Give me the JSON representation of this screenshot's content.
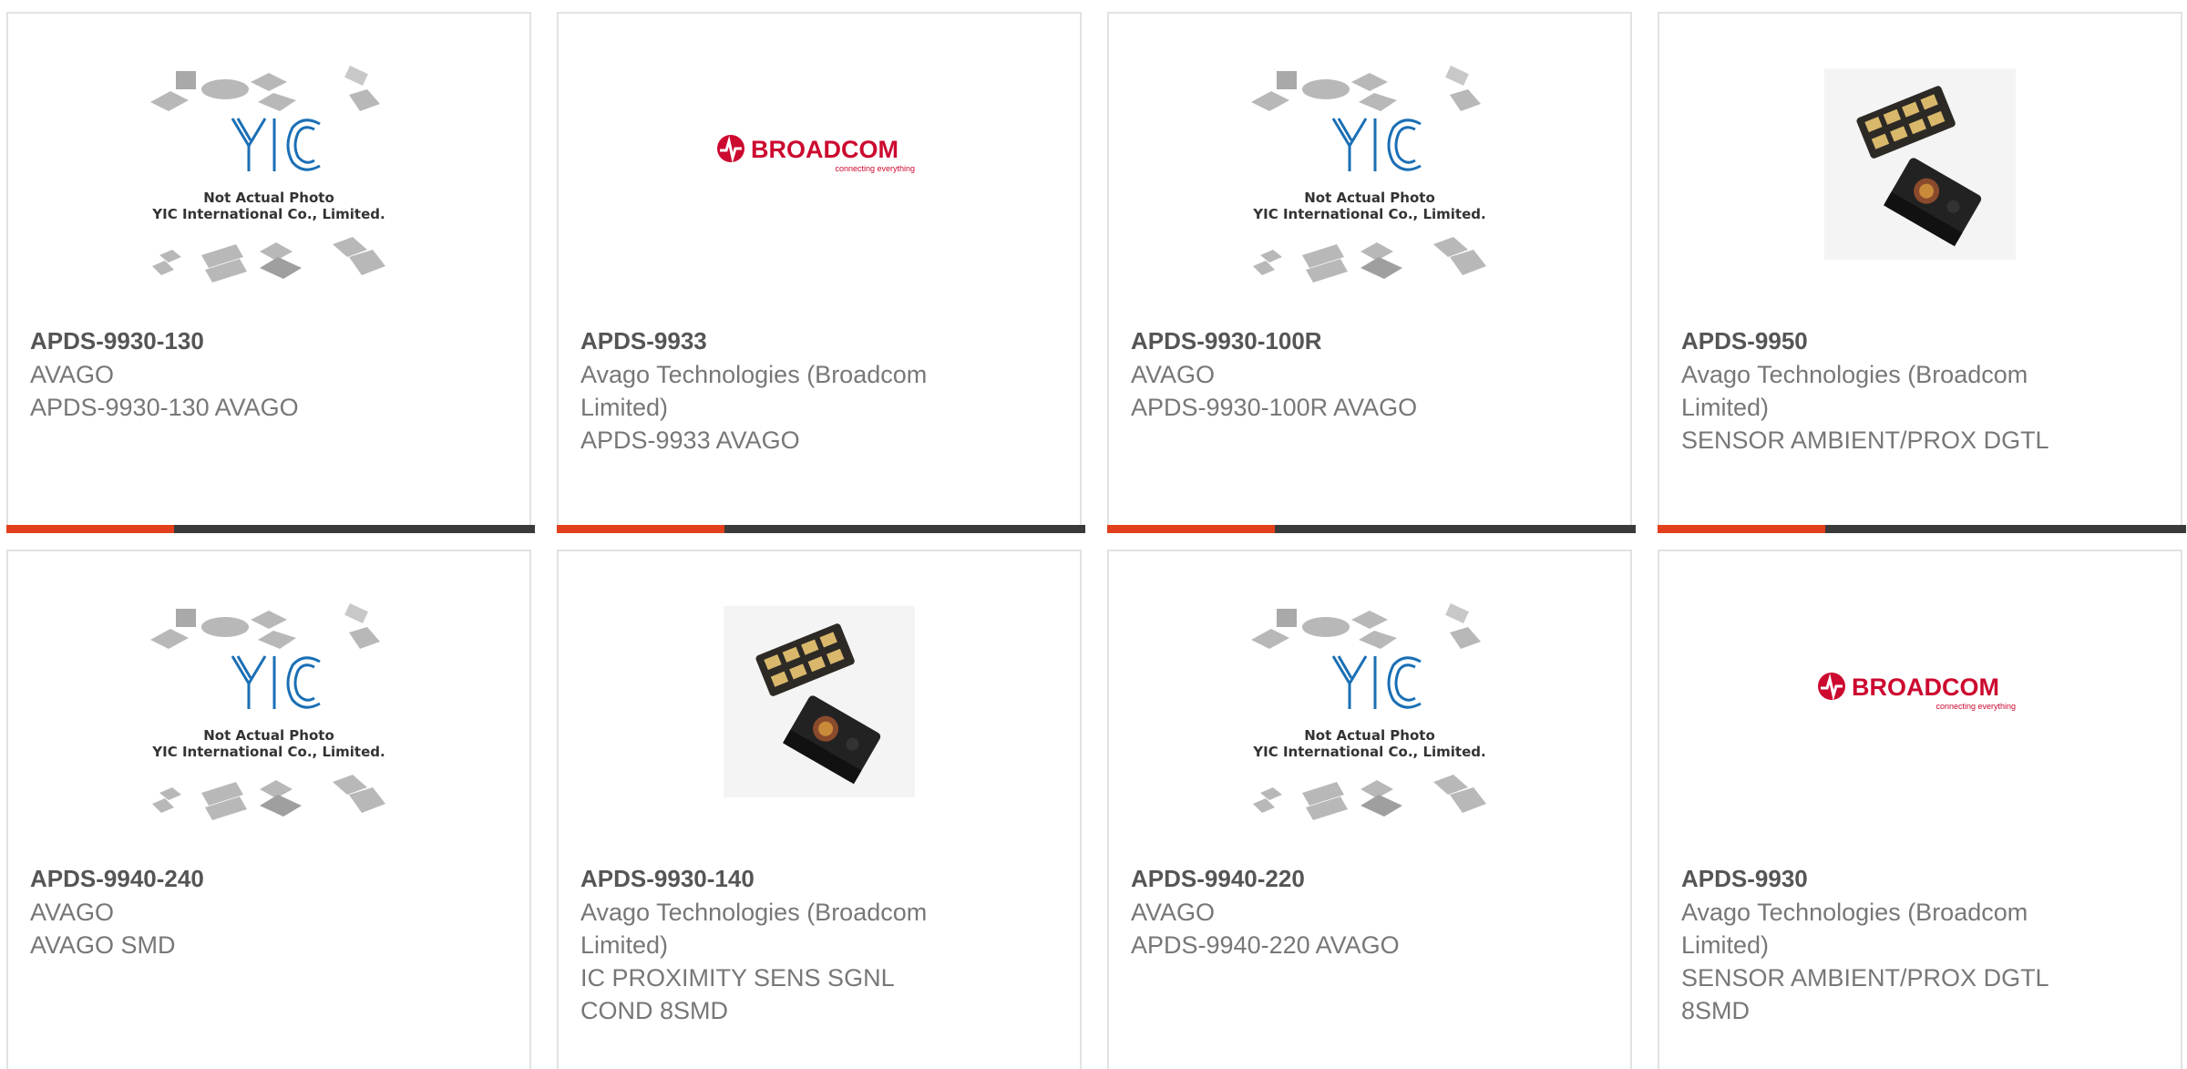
{
  "products": [
    {
      "part": "APDS-9930-130",
      "maker": "AVAGO",
      "desc": [
        "APDS-9930-130 AVAGO"
      ],
      "image": "yic-placeholder"
    },
    {
      "part": "APDS-9933",
      "maker": "Avago Technologies (Broadcom Limited)",
      "desc": [
        "APDS-9933 AVAGO"
      ],
      "image": "broadcom-logo"
    },
    {
      "part": "APDS-9930-100R",
      "maker": "AVAGO",
      "desc": [
        "APDS-9930-100R AVAGO"
      ],
      "image": "yic-placeholder"
    },
    {
      "part": "APDS-9950",
      "maker": "Avago Technologies (Broadcom Limited)",
      "desc": [
        "SENSOR AMBIENT/PROX DGTL"
      ],
      "image": "sensor-chip-photo"
    },
    {
      "part": "APDS-9940-240",
      "maker": "AVAGO",
      "desc": [
        "AVAGO SMD"
      ],
      "image": "yic-placeholder"
    },
    {
      "part": "APDS-9930-140",
      "maker": "Avago Technologies (Broadcom Limited)",
      "desc": [
        "IC PROXIMITY SENS SGNL",
        "COND 8SMD"
      ],
      "image": "sensor-chip-photo"
    },
    {
      "part": "APDS-9940-220",
      "maker": "AVAGO",
      "desc": [
        "APDS-9940-220 AVAGO"
      ],
      "image": "yic-placeholder"
    },
    {
      "part": "APDS-9930",
      "maker": "Avago Technologies (Broadcom Limited)",
      "desc": [
        "SENSOR AMBIENT/PROX DGTL",
        "8SMD"
      ],
      "image": "broadcom-logo"
    }
  ],
  "placeholder": {
    "line1": "Not Actual Photo",
    "line2": "YIC International Co., Limited.",
    "logo": "YIC"
  },
  "broadcom": {
    "name": "BROADCOM",
    "tagline": "connecting everything"
  },
  "colors": {
    "accent": "#e2401c",
    "accent_dark": "#3a3a3a",
    "title": "#555555",
    "text": "#777777",
    "border": "#e2e2e2"
  }
}
